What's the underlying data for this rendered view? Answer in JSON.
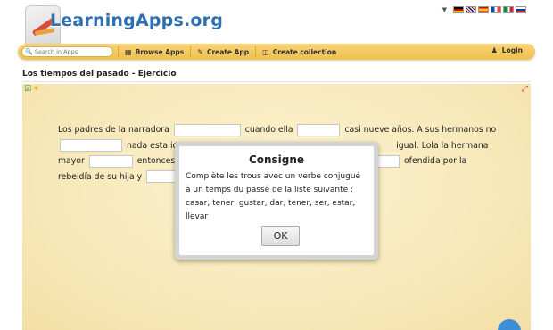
{
  "header": {
    "logo_text": "LearningApps.org",
    "flags": [
      {
        "name": "de-flag-icon"
      },
      {
        "name": "en-flag-icon"
      },
      {
        "name": "es-flag-icon"
      },
      {
        "name": "fr-flag-icon"
      },
      {
        "name": "it-flag-icon"
      },
      {
        "name": "ru-flag-icon"
      }
    ]
  },
  "navbar": {
    "search_placeholder": "Search in Apps",
    "items": [
      {
        "label": "Browse Apps",
        "icon": "grid-icon"
      },
      {
        "label": "Create App",
        "icon": "pencil-icon"
      },
      {
        "label": "Create collection",
        "icon": "collection-icon"
      }
    ],
    "login_label": "Login"
  },
  "page": {
    "title": "Los tiempos del pasado - Ejercicio"
  },
  "exercise": {
    "t1": "Los padres de la narradora",
    "t2": "cuando ella",
    "t3": "casi nueve años. A sus hermanos no",
    "t4": "nada esta ide",
    "t5": "igual. Lola la hermana",
    "t6": "mayor",
    "t7": "entonces d",
    "t8": "ofendida por la",
    "t9": "rebeldía de su hija y"
  },
  "modal": {
    "title": "Consigne",
    "text": "Complète les trous avec un verbe conjugué à un temps du passé de la liste suivante : casar, tener, gustar, dar, tener, ser, estar, llevar",
    "ok_label": "OK"
  },
  "colors": {
    "navbar": "#f0bf4a",
    "logo": "#2d6fb0",
    "app_bg": "#f7e7b6"
  }
}
